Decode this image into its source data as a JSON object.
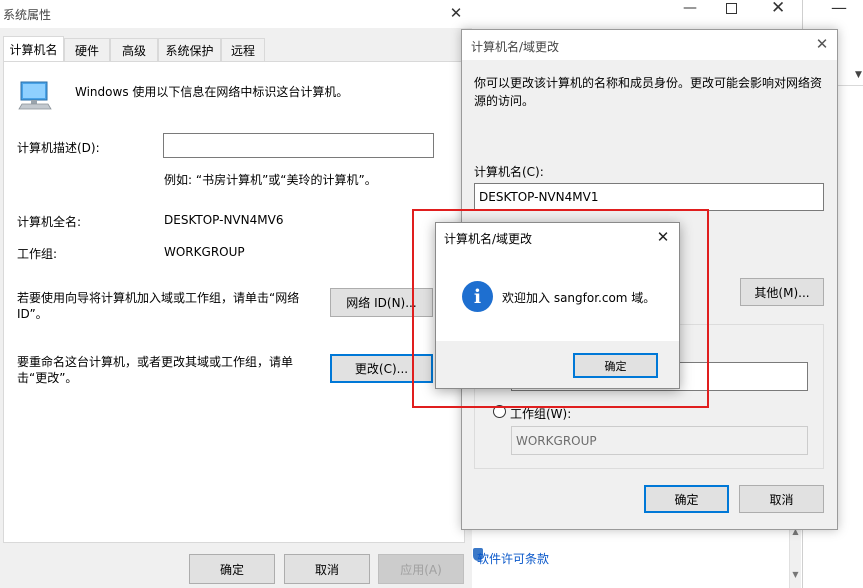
{
  "system_properties": {
    "title": "系统属性",
    "tabs": [
      "计算机名",
      "硬件",
      "高级",
      "系统保护",
      "远程"
    ],
    "info_text": "Windows 使用以下信息在网络中标识这台计算机。",
    "desc_label": "计算机描述(D):",
    "desc_value": "",
    "desc_example": "例如: “书房计算机”或“美玲的计算机”。",
    "fullname_label": "计算机全名:",
    "fullname_value": "DESKTOP-NVN4MV6",
    "workgroup_label": "工作组:",
    "workgroup_value": "WORKGROUP",
    "network_text": "若要使用向导将计算机加入域或工作组，请单击“网络 ID”。",
    "network_button": "网络 ID(N)...",
    "change_text": "要重命名这台计算机，或者更改其域或工作组，请单击“更改”。",
    "change_button": "更改(C)...",
    "ok_button": "确定",
    "cancel_button": "取消",
    "apply_button": "应用(A)"
  },
  "background_window": {
    "license_link": "软件许可条款"
  },
  "name_change_dialog": {
    "title": "计算机名/域更改",
    "info_text": "你可以更改该计算机的名称和成员身份。更改可能会影响对网络资源的访问。",
    "name_label": "计算机名(C):",
    "name_value": "DESKTOP-NVN4MV1",
    "more_button": "其他(M)...",
    "domain_value": "",
    "workgroup_radio_label": "工作组(W):",
    "workgroup_value": "WORKGROUP",
    "ok_button": "确定",
    "cancel_button": "取消"
  },
  "message_dialog": {
    "title": "计算机名/域更改",
    "message": "欢迎加入 sangfor.com 域。",
    "ok_button": "确定",
    "icon": "info-icon"
  },
  "colors": {
    "accent": "#0078d7",
    "highlight_border": "#e01e1e",
    "info_icon": "#1e6fd0"
  }
}
